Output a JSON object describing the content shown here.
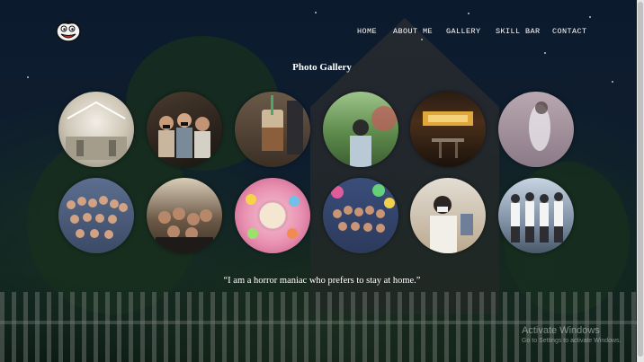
{
  "nav": {
    "home": "HOME",
    "about": "ABOUT ME",
    "gallery": "GALLERY",
    "skill": "SKILL BAR",
    "contact": "CONTACT"
  },
  "logo_icon": "cartoon-mascot-face-icon",
  "gallery": {
    "title": "Photo Gallery",
    "photos": [
      {
        "subject": "glass-roof-atrium"
      },
      {
        "subject": "friends-group-masked"
      },
      {
        "subject": "iced-coffee-drink"
      },
      {
        "subject": "person-in-garden"
      },
      {
        "subject": "lit-cafe-interior"
      },
      {
        "subject": "blurred-figure"
      },
      {
        "subject": "large-group-photo"
      },
      {
        "subject": "group-selfie"
      },
      {
        "subject": "party-table-food"
      },
      {
        "subject": "group-with-balloons"
      },
      {
        "subject": "masked-boy-selfie"
      },
      {
        "subject": "friends-posing-outdoors"
      }
    ]
  },
  "quote": "“I am a horror maniac who prefers to stay at home.”",
  "watermark": {
    "title": "Activate Windows",
    "subtitle": "Go to Settings to activate Windows."
  },
  "colors": {
    "nav_text": "#ffffff",
    "sky": "#10223a"
  }
}
